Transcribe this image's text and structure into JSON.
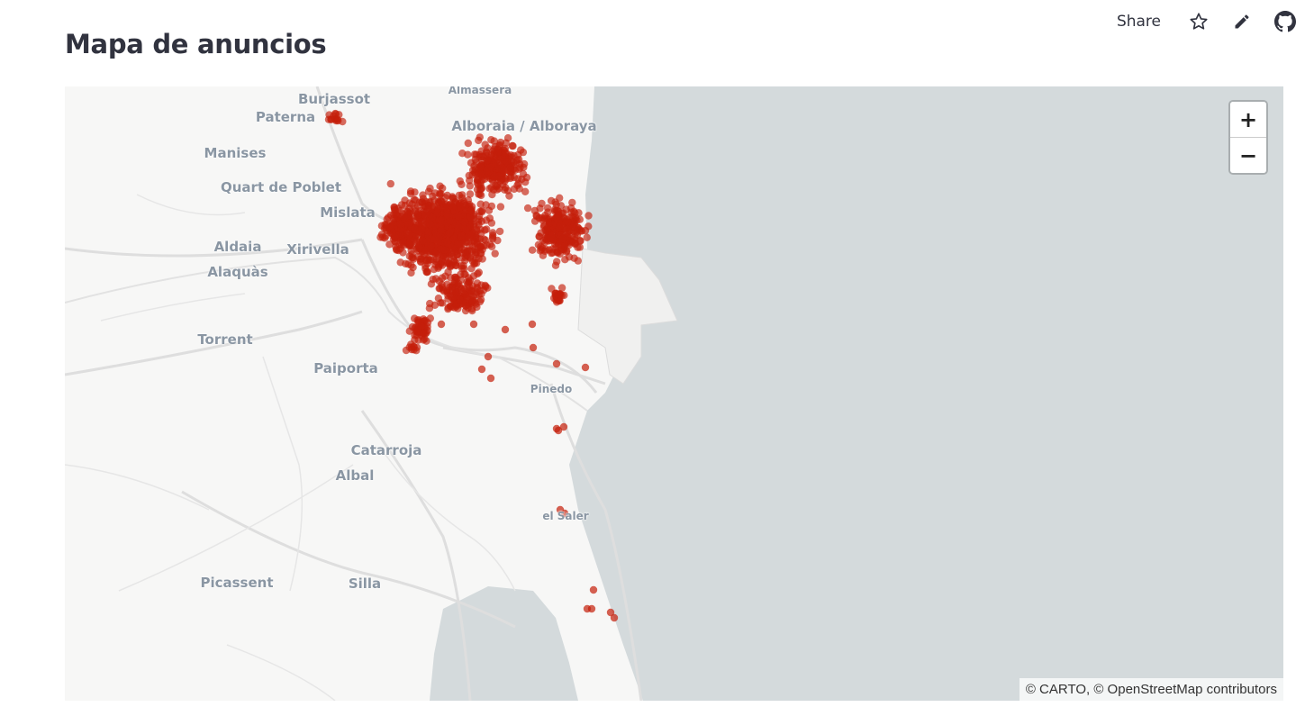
{
  "toolbar": {
    "share_label": "Share",
    "icons": [
      "star-icon",
      "edit-icon",
      "github-icon"
    ]
  },
  "page": {
    "title": "Mapa de anuncios"
  },
  "map": {
    "sea_color": "#d4dadc",
    "land_color": "#f7f7f6",
    "marker_color": "#c41e0a",
    "zoom_in_label": "+",
    "zoom_out_label": "−",
    "attribution": "© CARTO, © OpenStreetMap contributors",
    "places": [
      {
        "name": "Burjassot"
      },
      {
        "name": "Almàssera"
      },
      {
        "name": "Paterna"
      },
      {
        "name": "Alboraia / Alboraya"
      },
      {
        "name": "Manises"
      },
      {
        "name": "Quart de Poblet"
      },
      {
        "name": "Mislata"
      },
      {
        "name": "Aldaia"
      },
      {
        "name": "Xirivella"
      },
      {
        "name": "Alaquàs"
      },
      {
        "name": "Torrent"
      },
      {
        "name": "Paiporta"
      },
      {
        "name": "Pinedo"
      },
      {
        "name": "Catarroja"
      },
      {
        "name": "Albal"
      },
      {
        "name": "el Saler"
      },
      {
        "name": "Picassent"
      },
      {
        "name": "Silla"
      }
    ]
  }
}
